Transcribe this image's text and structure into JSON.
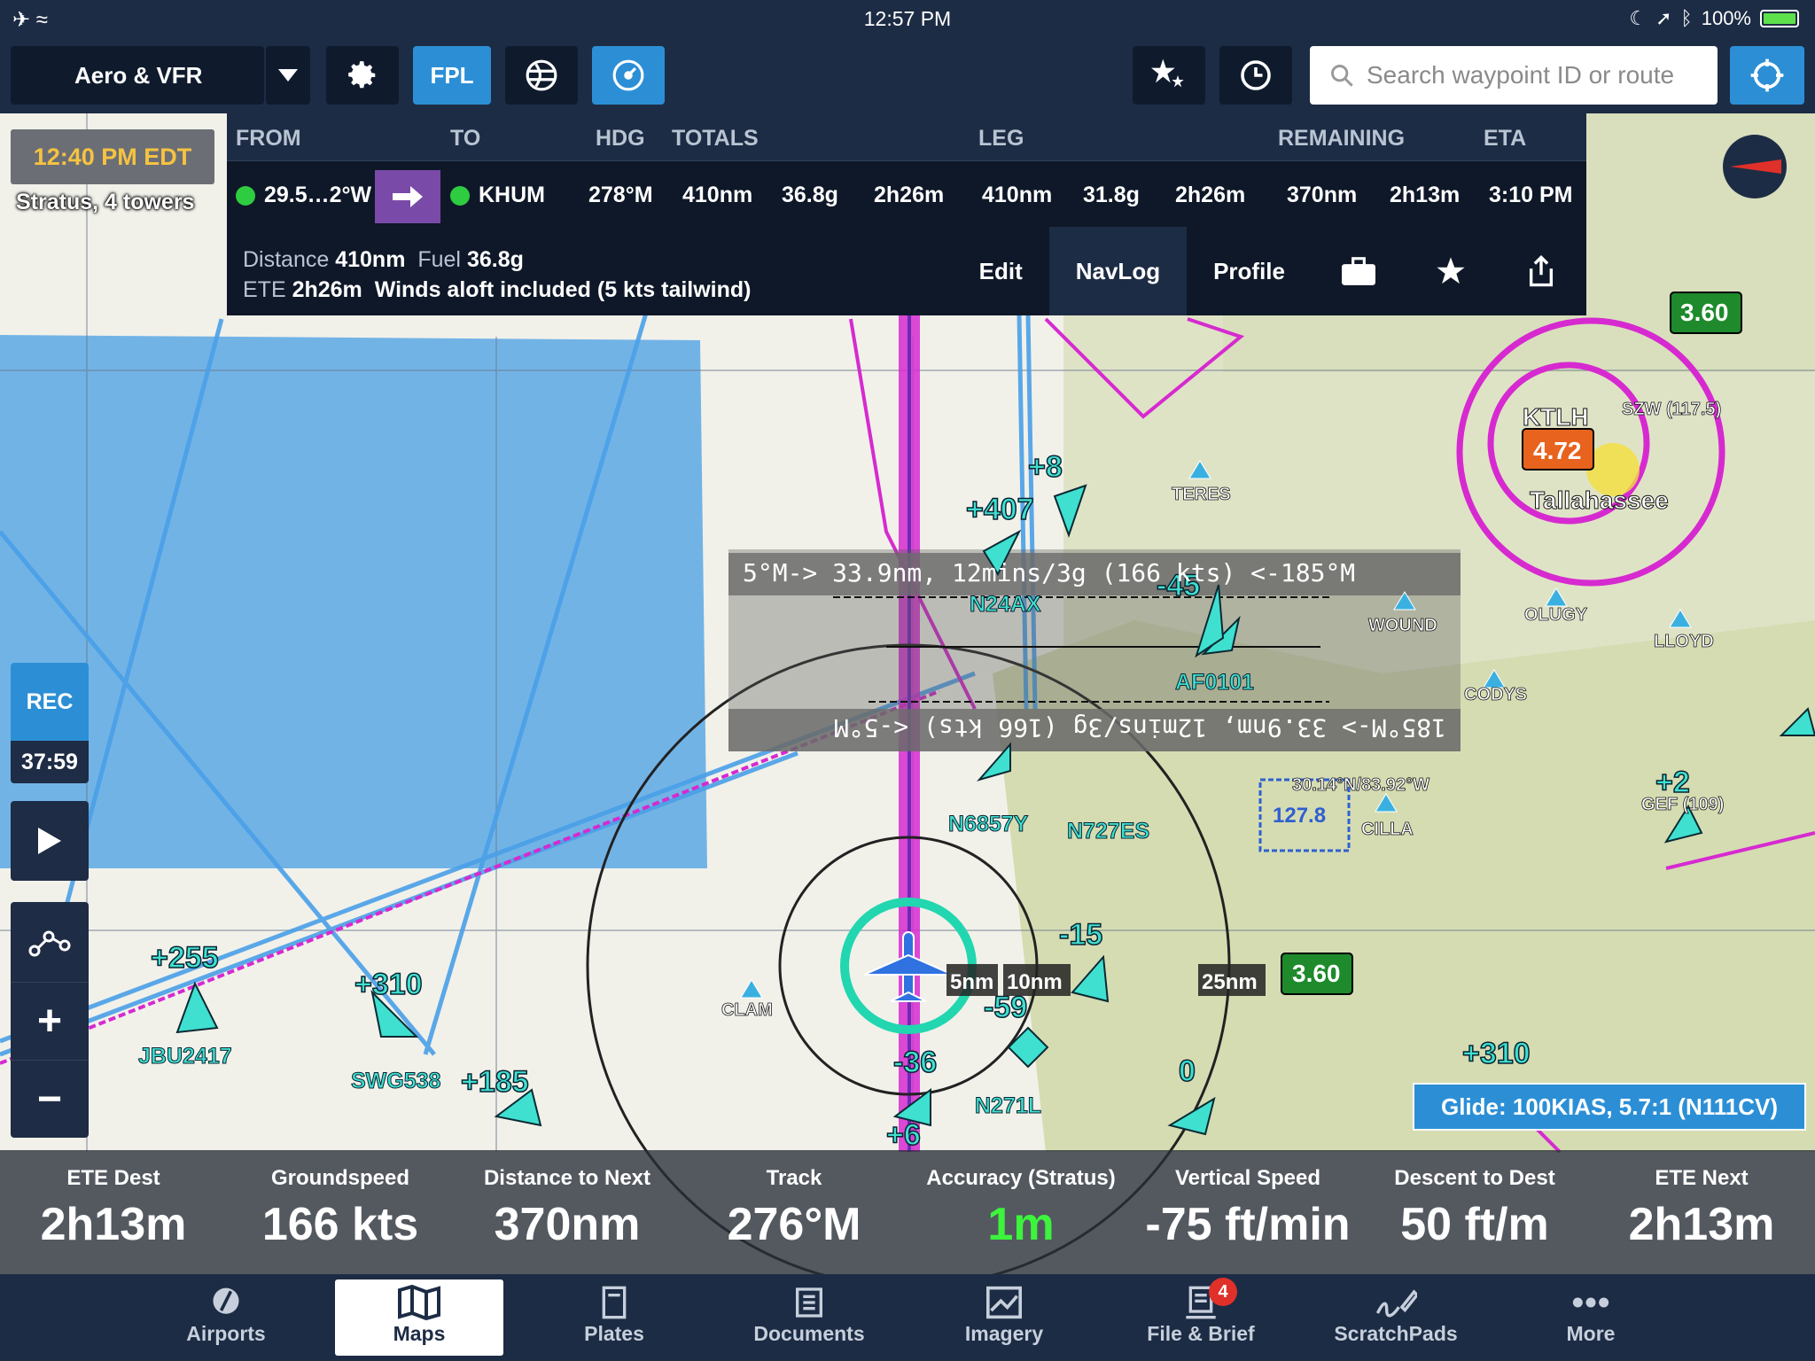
{
  "status_bar": {
    "time": "12:57 PM",
    "battery": "100%"
  },
  "toolbar": {
    "layer": "Aero & VFR",
    "fpl": "FPL",
    "search_placeholder": "Search waypoint ID or route"
  },
  "flight_plan": {
    "headers": {
      "from": "FROM",
      "to": "TO",
      "hdg": "HDG",
      "totals": "TOTALS",
      "leg": "LEG",
      "remaining": "REMAINING",
      "eta": "ETA"
    },
    "from": "29.5…2°W",
    "to": "KHUM",
    "hdg": "278°M",
    "totals": {
      "distance": "410nm",
      "fuel": "36.8g",
      "time": "2h26m"
    },
    "leg": {
      "distance": "410nm",
      "fuel": "31.8g",
      "time": "2h26m"
    },
    "remaining": {
      "distance": "370nm",
      "time": "2h13m"
    },
    "eta": "3:10 PM",
    "info": {
      "distance_label": "Distance",
      "distance": "410nm",
      "fuel_label": "Fuel",
      "fuel": "36.8g",
      "ete_label": "ETE",
      "ete": "2h26m",
      "winds": "Winds aloft included (5 kts tailwind)"
    },
    "tabs": {
      "edit": "Edit",
      "navlog": "NavLog",
      "profile": "Profile"
    }
  },
  "left": {
    "time_badge": "12:40 PM EDT",
    "stratus": "Stratus, 4 towers",
    "rec": "REC",
    "rec_time": "37:59"
  },
  "glide": "Glide: 100KIAS, 5.7:1 (N111CV)",
  "map_labels": {
    "ruler_top": "5°M-> 33.9nm, 12mins/3g (166 kts) <-185°M",
    "ruler_bottom": "185°M-> 33.9nm, 12mins/3g (166 kts) <-5°M",
    "ktlh": "KTLH",
    "ktlh_wx": "4.72",
    "tallahassee": "Tallahassee",
    "szw": "SZW (117.5)",
    "wx_top": "3.60",
    "wx_mid": "3.60",
    "freq": "127.8",
    "coords": "30.14°N/83.92°W",
    "waypoints": [
      "TERES",
      "WOUND",
      "OLUGY",
      "LLOYD",
      "CODYS",
      "CILLA",
      "CLAM",
      "GEF (109)"
    ],
    "ranges": [
      "5nm",
      "10nm",
      "25nm"
    ],
    "traffic": [
      {
        "alt": "+407",
        "id": ""
      },
      {
        "alt": "+8",
        "id": ""
      },
      {
        "alt": "-45",
        "id": "N24AX"
      },
      {
        "alt": "",
        "id": "AF0101"
      },
      {
        "alt": "",
        "id": "N6857Y"
      },
      {
        "alt": "",
        "id": "N727ES"
      },
      {
        "alt": "-15",
        "id": ""
      },
      {
        "alt": "-59",
        "id": ""
      },
      {
        "alt": "-36",
        "id": "N271L"
      },
      {
        "alt": "+255",
        "id": "JBU2417"
      },
      {
        "alt": "+310",
        "id": "SWG538"
      },
      {
        "alt": "+185",
        "id": ""
      },
      {
        "alt": "+2",
        "id": ""
      },
      {
        "alt": "+310",
        "id": ""
      },
      {
        "alt": "0",
        "id": ""
      },
      {
        "alt": "+6",
        "id": ""
      }
    ]
  },
  "instruments": [
    {
      "label": "ETE Dest",
      "value": "2h13m"
    },
    {
      "label": "Groundspeed",
      "value": "166 kts"
    },
    {
      "label": "Distance to Next",
      "value": "370nm"
    },
    {
      "label": "Track",
      "value": "276°M"
    },
    {
      "label": "Accuracy (Stratus)",
      "value": "1m"
    },
    {
      "label": "Vertical Speed",
      "value": "-75 ft/min"
    },
    {
      "label": "Descent to Dest",
      "value": "50 ft/m"
    },
    {
      "label": "ETE Next",
      "value": "2h13m"
    }
  ],
  "tabbar": [
    {
      "label": "Airports",
      "icon": "airports-icon"
    },
    {
      "label": "Maps",
      "icon": "maps-icon"
    },
    {
      "label": "Plates",
      "icon": "plates-icon"
    },
    {
      "label": "Documents",
      "icon": "documents-icon"
    },
    {
      "label": "Imagery",
      "icon": "imagery-icon"
    },
    {
      "label": "File & Brief",
      "icon": "file-brief-icon",
      "badge": "4"
    },
    {
      "label": "ScratchPads",
      "icon": "scratchpads-icon"
    },
    {
      "label": "More",
      "icon": "more-icon"
    }
  ],
  "colors": {
    "toolbar": "#1d2c45",
    "accent": "#2c8fd6",
    "route": "#d62ad0",
    "traffic": "#3fe0d0",
    "restricted": "#6fb3e6"
  }
}
